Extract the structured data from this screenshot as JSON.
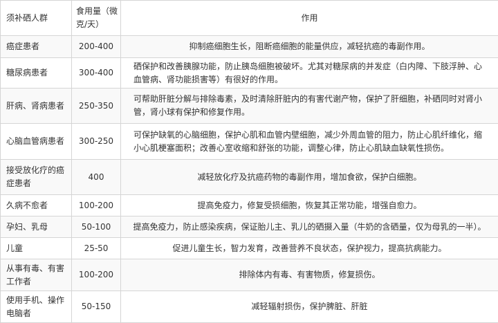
{
  "header": {
    "group": "须补硒人群",
    "dose": "食用量（微克/天）",
    "effect": "作用"
  },
  "rows": [
    {
      "group": "癌症患者",
      "dose": "200-400",
      "effect": "抑制癌细胞生长，阻断癌细胞的能量供应，减轻抗癌的毒副作用。"
    },
    {
      "group": "糖尿病患者",
      "dose": "300-400",
      "effect": "硒保护和改善胰腺功能，防止胰岛细胞被破坏。尤其对糖尿病的并发症（白内障、下肢浮肿、心血管病、肾功能损害等）有很好的作用。"
    },
    {
      "group": "肝病、肾病患者",
      "dose": "250-350",
      "effect": "可帮助肝脏分解与排除毒素，及时清除肝脏内的有害代谢产物，保护了肝细胞，补硒同时对肾小管，肾小球有保护和修复作用。"
    },
    {
      "group": "心脑血管病患者",
      "dose": "300-250",
      "effect": "可保护缺氧的心脑细胞，保护心肌和血管内壁细胞，减少外周血管的阻力，防止心肌纤维化，缩小心肌梗塞面积；改善心室收缩和舒张的功能，调整心律，防止心肌缺血缺氧性损伤。"
    },
    {
      "group": "接受放化疗的癌症患者",
      "dose": "400",
      "effect": "减轻放化疗及抗癌药物的毒副作用，增加食欲，保护白细胞。"
    },
    {
      "group": "久病不愈者",
      "dose": "100-200",
      "effect": "提高免疫力，修复受损细胞，恢复其正常功能，增强自愈力。"
    },
    {
      "group": "孕妇、乳母",
      "dose": "50-100",
      "effect": "提高免疫力，防止感染疾病，保证胎儿主、乳儿的硒摄入量（牛奶的含硒量，仅为母乳的一半）。"
    },
    {
      "group": "儿童",
      "dose": "25-50",
      "effect": "促进儿童生长，智力发育，改善营养不良状态，保护视力，提高抗病能力。"
    },
    {
      "group": "从事有毒、有害工作者",
      "dose": "100-200",
      "effect": "排除体内有毒、有害物质，修复损伤。"
    },
    {
      "group": "使用手机、操作电脑者",
      "dose": "50-150",
      "effect": "减轻辐射损伤，保护脾脏、肝脏"
    }
  ]
}
